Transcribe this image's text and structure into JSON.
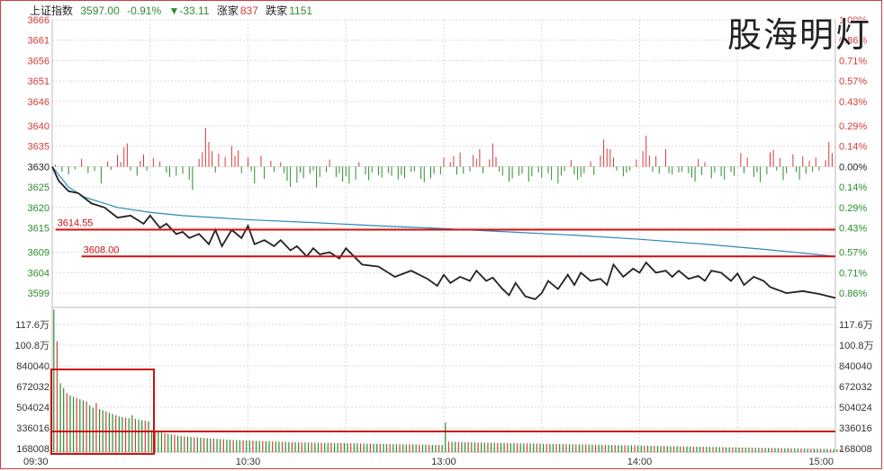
{
  "header": {
    "title": "上证指数",
    "price": "3597.00",
    "pct": "-0.91%",
    "change": "▼-33.11",
    "up_label": "涨家",
    "up_count": "837",
    "down_label": "跌家",
    "down_count": "1151"
  },
  "watermark": "股海明灯",
  "colors": {
    "up": "#d63a3a",
    "down": "#2e8b2e",
    "price_line": "#222222",
    "avg_line": "#2a8ab8",
    "grid": "#d9d9d9",
    "frame": "#d04040",
    "mark": "#cc1111"
  },
  "chart_data": [
    {
      "type": "line",
      "panel": "price",
      "y_ticks_left": [
        "3666",
        "3661",
        "3656",
        "3651",
        "3646",
        "3640",
        "3635",
        "3630",
        "3625",
        "3620",
        "3615",
        "3609",
        "3604",
        "3599"
      ],
      "y_ticks_right": [
        "1.00%",
        "0.86%",
        "0.71%",
        "0.57%",
        "0.43%",
        "0.29%",
        "0.14%",
        "0.00%",
        "0.14%",
        "0.29%",
        "0.43%",
        "0.57%",
        "0.71%",
        "0.86%"
      ],
      "ylim": [
        3595.5,
        3666
      ],
      "x_ticks": [
        "09:30",
        "10:30",
        "13:00",
        "14:00",
        "15:00"
      ],
      "prev_close": 3630,
      "series": [
        {
          "role": "price",
          "x": [
            0,
            2,
            5,
            8,
            12,
            16,
            20,
            24,
            28,
            30,
            33,
            35,
            38,
            40,
            42,
            45,
            48,
            50,
            52,
            55,
            58,
            60,
            62,
            65,
            68,
            70,
            73,
            75,
            78,
            80,
            82,
            85,
            88,
            90,
            95,
            100,
            105,
            110,
            115,
            118,
            120,
            122,
            125,
            128,
            130,
            133,
            135,
            138,
            140,
            142,
            145,
            148,
            150,
            152,
            155,
            158,
            160,
            162,
            165,
            168,
            170,
            172,
            175,
            178,
            180,
            182,
            185,
            188,
            190,
            192,
            195,
            198,
            200,
            202,
            205,
            208,
            210,
            212,
            215,
            218,
            220,
            225,
            230,
            235,
            240
          ],
          "y": [
            3630,
            3626.5,
            3624,
            3623.5,
            3621,
            3620,
            3617.5,
            3618,
            3616,
            3618,
            3615,
            3616,
            3613.5,
            3614,
            3612.5,
            3613.5,
            3611,
            3614.5,
            3610.5,
            3614.5,
            3612.5,
            3615.5,
            3611,
            3612,
            3610.5,
            3612,
            3609.5,
            3610.5,
            3608,
            3610,
            3608.5,
            3609,
            3607.5,
            3610,
            3606,
            3605.5,
            3603,
            3604.5,
            3602.5,
            3600.8,
            3603.5,
            3601.5,
            3603,
            3602,
            3604.5,
            3602,
            3602.8,
            3600,
            3598.5,
            3601.5,
            3598.2,
            3597.5,
            3599,
            3602,
            3600,
            3603.5,
            3601,
            3604,
            3602,
            3602.5,
            3601,
            3606,
            3603,
            3605,
            3604,
            3606.5,
            3604,
            3604.5,
            3603,
            3604.5,
            3602.5,
            3603.2,
            3602,
            3604.5,
            3604,
            3602,
            3603.8,
            3601,
            3603,
            3602,
            3600.5,
            3599,
            3599.5,
            3598.8,
            3597.8
          ]
        },
        {
          "role": "average",
          "x": [
            0,
            5,
            10,
            20,
            30,
            40,
            60,
            80,
            100,
            120,
            140,
            160,
            180,
            200,
            220,
            240
          ],
          "y": [
            3630,
            3625,
            3622.5,
            3620,
            3618.8,
            3618,
            3617,
            3616.3,
            3615.5,
            3614.8,
            3614,
            3613.2,
            3612.2,
            3611,
            3609.6,
            3608
          ]
        }
      ],
      "breadth_bars": [
        {
          "x": 1,
          "v": 0.3
        },
        {
          "x": 3,
          "v": -0.8
        },
        {
          "x": 5,
          "v": -1.2
        },
        {
          "x": 7,
          "v": -0.4
        },
        {
          "x": 9,
          "v": 1.2
        },
        {
          "x": 11,
          "v": -1.0
        },
        {
          "x": 13,
          "v": -0.7
        },
        {
          "x": 15,
          "v": -2.6
        },
        {
          "x": 17,
          "v": 0.8
        },
        {
          "x": 18,
          "v": -0.5
        },
        {
          "x": 20,
          "v": 1.8
        },
        {
          "x": 21,
          "v": 0.7
        },
        {
          "x": 22,
          "v": 3.0
        },
        {
          "x": 23,
          "v": 3.6
        },
        {
          "x": 24,
          "v": -0.6
        },
        {
          "x": 26,
          "v": -1.4
        },
        {
          "x": 27,
          "v": 0.9
        },
        {
          "x": 28,
          "v": 1.9
        },
        {
          "x": 29,
          "v": -0.6
        },
        {
          "x": 31,
          "v": 1.3
        },
        {
          "x": 33,
          "v": 0.8
        },
        {
          "x": 35,
          "v": -0.9
        },
        {
          "x": 36,
          "v": -1.6
        },
        {
          "x": 38,
          "v": -1.4
        },
        {
          "x": 40,
          "v": -1.1
        },
        {
          "x": 42,
          "v": -2.0
        },
        {
          "x": 43,
          "v": -3.6
        },
        {
          "x": 45,
          "v": 1.2
        },
        {
          "x": 46,
          "v": 2.2
        },
        {
          "x": 47,
          "v": 6.0
        },
        {
          "x": 48,
          "v": 3.8
        },
        {
          "x": 49,
          "v": 2.4
        },
        {
          "x": 50,
          "v": -0.9
        },
        {
          "x": 51,
          "v": 2.0
        },
        {
          "x": 53,
          "v": 1.5
        },
        {
          "x": 55,
          "v": 3.2
        },
        {
          "x": 56,
          "v": 1.7
        },
        {
          "x": 57,
          "v": 2.5
        },
        {
          "x": 58,
          "v": -1.0
        },
        {
          "x": 60,
          "v": 1.4
        },
        {
          "x": 61,
          "v": -0.7
        },
        {
          "x": 62,
          "v": -2.6
        },
        {
          "x": 64,
          "v": 1.7
        },
        {
          "x": 65,
          "v": -1.9
        },
        {
          "x": 67,
          "v": 0.9
        },
        {
          "x": 68,
          "v": -0.8
        },
        {
          "x": 70,
          "v": 0.7
        },
        {
          "x": 71,
          "v": -1.0
        },
        {
          "x": 72,
          "v": -2.2
        },
        {
          "x": 73,
          "v": -3.1
        },
        {
          "x": 75,
          "v": -2.5
        },
        {
          "x": 76,
          "v": -0.9
        },
        {
          "x": 77,
          "v": -1.8
        },
        {
          "x": 79,
          "v": -1.1
        },
        {
          "x": 80,
          "v": -0.6
        },
        {
          "x": 81,
          "v": -3.2
        },
        {
          "x": 82,
          "v": -1.6
        },
        {
          "x": 84,
          "v": -0.8
        },
        {
          "x": 85,
          "v": 1.1
        },
        {
          "x": 87,
          "v": -1.6
        },
        {
          "x": 88,
          "v": -1.0
        },
        {
          "x": 89,
          "v": -2.3
        },
        {
          "x": 90,
          "v": -1.5
        },
        {
          "x": 91,
          "v": -2.6
        },
        {
          "x": 93,
          "v": -2.0
        },
        {
          "x": 94,
          "v": 0.7
        },
        {
          "x": 96,
          "v": -1.2
        },
        {
          "x": 97,
          "v": -2.1
        },
        {
          "x": 98,
          "v": -0.9
        },
        {
          "x": 100,
          "v": -1.3
        },
        {
          "x": 101,
          "v": -1.7
        },
        {
          "x": 103,
          "v": -1.0
        },
        {
          "x": 104,
          "v": -1.4
        },
        {
          "x": 106,
          "v": -2.0
        },
        {
          "x": 107,
          "v": -1.3
        },
        {
          "x": 108,
          "v": -1.8
        },
        {
          "x": 110,
          "v": -0.8
        },
        {
          "x": 111,
          "v": -0.7
        },
        {
          "x": 113,
          "v": -1.9
        },
        {
          "x": 114,
          "v": -2.4
        },
        {
          "x": 116,
          "v": -1.8
        },
        {
          "x": 117,
          "v": -1.1
        },
        {
          "x": 119,
          "v": -1.2
        },
        {
          "x": 120,
          "v": 1.4
        },
        {
          "x": 122,
          "v": 0.7
        },
        {
          "x": 123,
          "v": 1.6
        },
        {
          "x": 124,
          "v": -1.2
        },
        {
          "x": 125,
          "v": 2.2
        },
        {
          "x": 126,
          "v": -1.1
        },
        {
          "x": 128,
          "v": -0.7
        },
        {
          "x": 129,
          "v": 1.8
        },
        {
          "x": 130,
          "v": 1.2
        },
        {
          "x": 131,
          "v": 2.7
        },
        {
          "x": 132,
          "v": -1.0
        },
        {
          "x": 134,
          "v": 1.1
        },
        {
          "x": 135,
          "v": 3.6
        },
        {
          "x": 136,
          "v": 1.5
        },
        {
          "x": 137,
          "v": -0.8
        },
        {
          "x": 138,
          "v": -1.4
        },
        {
          "x": 140,
          "v": -2.3
        },
        {
          "x": 141,
          "v": -1.8
        },
        {
          "x": 143,
          "v": -1.4
        },
        {
          "x": 144,
          "v": -1.1
        },
        {
          "x": 146,
          "v": -2.3
        },
        {
          "x": 147,
          "v": -1.5
        },
        {
          "x": 149,
          "v": -0.9
        },
        {
          "x": 150,
          "v": -1.7
        },
        {
          "x": 152,
          "v": -1.0
        },
        {
          "x": 153,
          "v": -2.1
        },
        {
          "x": 155,
          "v": -2.6
        },
        {
          "x": 156,
          "v": -1.4
        },
        {
          "x": 157,
          "v": -0.7
        },
        {
          "x": 159,
          "v": 1.0
        },
        {
          "x": 160,
          "v": -1.2
        },
        {
          "x": 161,
          "v": -2.0
        },
        {
          "x": 162,
          "v": -1.6
        },
        {
          "x": 163,
          "v": -1.0
        },
        {
          "x": 165,
          "v": 0.8
        },
        {
          "x": 166,
          "v": -1.3
        },
        {
          "x": 168,
          "v": 1.7
        },
        {
          "x": 169,
          "v": 4.2
        },
        {
          "x": 170,
          "v": 2.8
        },
        {
          "x": 171,
          "v": 2.7
        },
        {
          "x": 172,
          "v": 1.4
        },
        {
          "x": 173,
          "v": -0.6
        },
        {
          "x": 175,
          "v": -1.5
        },
        {
          "x": 176,
          "v": -0.9
        },
        {
          "x": 177,
          "v": -0.6
        },
        {
          "x": 179,
          "v": 1.1
        },
        {
          "x": 181,
          "v": 2.4
        },
        {
          "x": 182,
          "v": 4.8
        },
        {
          "x": 183,
          "v": 1.7
        },
        {
          "x": 184,
          "v": -0.8
        },
        {
          "x": 185,
          "v": 1.6
        },
        {
          "x": 186,
          "v": -1.1
        },
        {
          "x": 188,
          "v": 2.7
        },
        {
          "x": 189,
          "v": -1.0
        },
        {
          "x": 190,
          "v": -1.2
        },
        {
          "x": 192,
          "v": -0.9
        },
        {
          "x": 193,
          "v": -0.8
        },
        {
          "x": 195,
          "v": -1.0
        },
        {
          "x": 196,
          "v": -1.7
        },
        {
          "x": 197,
          "v": -2.3
        },
        {
          "x": 198,
          "v": 1.2
        },
        {
          "x": 199,
          "v": -1.3
        },
        {
          "x": 200,
          "v": 0.7
        },
        {
          "x": 202,
          "v": -1.8
        },
        {
          "x": 203,
          "v": -0.9
        },
        {
          "x": 205,
          "v": -1.5
        },
        {
          "x": 206,
          "v": -2.0
        },
        {
          "x": 208,
          "v": -0.8
        },
        {
          "x": 209,
          "v": -1.4
        },
        {
          "x": 211,
          "v": 2.1
        },
        {
          "x": 212,
          "v": -1.0
        },
        {
          "x": 213,
          "v": 1.4
        },
        {
          "x": 215,
          "v": -1.6
        },
        {
          "x": 216,
          "v": -0.9
        },
        {
          "x": 217,
          "v": -2.4
        },
        {
          "x": 219,
          "v": -1.2
        },
        {
          "x": 220,
          "v": 2.2
        },
        {
          "x": 221,
          "v": 2.6
        },
        {
          "x": 222,
          "v": -0.6
        },
        {
          "x": 223,
          "v": 1.3
        },
        {
          "x": 224,
          "v": -2.1
        },
        {
          "x": 225,
          "v": -1.0
        },
        {
          "x": 227,
          "v": 1.9
        },
        {
          "x": 228,
          "v": -0.8
        },
        {
          "x": 229,
          "v": -2.0
        },
        {
          "x": 230,
          "v": 1.6
        },
        {
          "x": 231,
          "v": -1.1
        },
        {
          "x": 232,
          "v": 0.9
        },
        {
          "x": 233,
          "v": -0.8
        },
        {
          "x": 234,
          "v": 1.4
        },
        {
          "x": 235,
          "v": -0.6
        },
        {
          "x": 237,
          "v": 1.0
        },
        {
          "x": 238,
          "v": 3.8
        },
        {
          "x": 239,
          "v": 2.1
        }
      ],
      "annotations": [
        {
          "label": "3614.55",
          "value": 3614.55,
          "x_from": 1
        },
        {
          "label": "3608.00",
          "value": 3608.0,
          "x_from": 9
        }
      ]
    },
    {
      "type": "bar",
      "panel": "volume",
      "y_ticks": [
        "117.6万",
        "100.8万",
        "840040",
        "672032",
        "504024",
        "336016",
        "168008"
      ],
      "ylim": [
        0,
        1176000
      ],
      "volumes": [
        1160000,
        900000,
        560000,
        520000,
        480000,
        460000,
        450000,
        440000,
        430000,
        420000,
        410000,
        380000,
        360000,
        400000,
        350000,
        340000,
        330000,
        320000,
        310000,
        300000,
        290000,
        285000,
        280000,
        275000,
        300000,
        270000,
        265000,
        260000,
        255000,
        250000,
        180000,
        170000,
        165000,
        160000,
        155000,
        150000,
        145000,
        140000,
        135000,
        130000,
        128000,
        126000,
        124000,
        122000,
        120000,
        118000,
        116000,
        114000,
        112000,
        110000,
        108000,
        106000,
        104000,
        102000,
        100000,
        99000,
        98000,
        97000,
        96000,
        95000,
        94000,
        93000,
        92000,
        91000,
        90000,
        89000,
        88000,
        87000,
        86000,
        85000,
        84000,
        83000,
        82000,
        81000,
        80000,
        80000,
        79000,
        79000,
        78000,
        78000,
        77000,
        77000,
        76000,
        76000,
        75000,
        75000,
        74000,
        74000,
        73000,
        73000,
        72000,
        72000,
        71000,
        71000,
        70000,
        70000,
        69000,
        69000,
        68000,
        68000,
        67000,
        67000,
        66000,
        66000,
        65000,
        65000,
        64000,
        64000,
        63000,
        63000,
        62000,
        62000,
        61000,
        61000,
        60000,
        60000,
        59000,
        59000,
        58000,
        58000,
        240000,
        85000,
        84000,
        83000,
        82000,
        81000,
        80000,
        80000,
        79000,
        79000,
        78000,
        78000,
        77000,
        77000,
        76000,
        76000,
        75000,
        75000,
        74000,
        74000,
        73000,
        73000,
        72000,
        72000,
        71000,
        71000,
        70000,
        70000,
        69000,
        69000,
        68000,
        68000,
        67000,
        67000,
        66000,
        66000,
        65000,
        65000,
        64000,
        64000,
        63000,
        63000,
        62000,
        62000,
        61000,
        61000,
        60000,
        60000,
        59000,
        59000,
        58000,
        58000,
        57000,
        57000,
        56000,
        56000,
        55000,
        55000,
        54000,
        54000,
        53000,
        53000,
        52000,
        52000,
        51000,
        51000,
        50000,
        50000,
        49000,
        49000,
        48000,
        48000,
        47000,
        47000,
        46000,
        46000,
        45000,
        45000,
        44000,
        44000,
        43000,
        43000,
        42000,
        42000,
        41000,
        41000,
        40000,
        40000,
        39000,
        39000,
        38000,
        38000,
        37000,
        37000,
        36000,
        36000,
        35000,
        35000,
        34000,
        34000,
        33000,
        33000,
        32000,
        32000,
        31000,
        31000,
        30000,
        30000,
        29000,
        29000,
        28000,
        28000,
        27000,
        27000,
        26000,
        26000,
        25000,
        25000,
        24000,
        24000,
        23000,
        23000
      ]
    }
  ]
}
